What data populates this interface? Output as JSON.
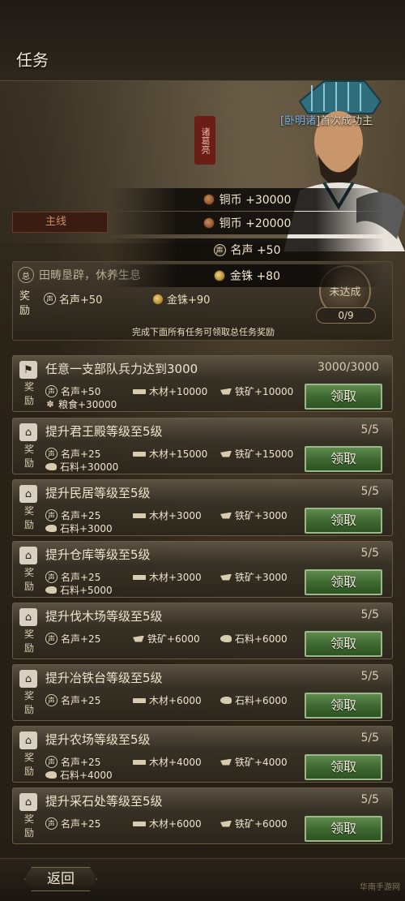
{
  "header": {
    "title": "任务"
  },
  "hero": {
    "caption_name": "[卧明诸",
    "caption_text": "]首次成功主",
    "seal_text": "诸葛亮"
  },
  "popup": {
    "rewards": [
      {
        "icon": "copper-coin-icon",
        "text": "铜币 +30000"
      },
      {
        "icon": "copper-coin-icon",
        "text": "铜币 +20000"
      },
      {
        "icon": "fame-icon",
        "text": "名声 +50"
      },
      {
        "icon": "gold-coin-icon",
        "text": "金铢 +80"
      }
    ],
    "mainline_tab": "主线"
  },
  "chapter": {
    "badge": "总",
    "title": "田畴垦辟，休养生息",
    "reward_label": "奖励",
    "rewards": [
      {
        "icon": "fame-icon",
        "text": "名声+50"
      },
      {
        "icon": "gold-coin-icon",
        "text": "金铢+90"
      }
    ],
    "chest_label": "未达成",
    "progress": "0/9",
    "hint": "完成下面所有任务可领取总任务奖励"
  },
  "reward_label": "奖励",
  "claim_label": "领取",
  "tasks": [
    {
      "title": "任意一支部队兵力达到3000",
      "progress": "3000/3000",
      "icon": "flag-icon",
      "rewards": [
        {
          "icon": "fame-icon",
          "text": "名声+50"
        },
        {
          "icon": "wood-icon",
          "text": "木材+10000"
        },
        {
          "icon": "iron-icon",
          "text": "铁矿+10000"
        },
        {
          "icon": "grain-icon",
          "text": "粮食+30000"
        }
      ]
    },
    {
      "title": "提升君王殿等级至5级",
      "progress": "5/5",
      "icon": "palace-icon",
      "rewards": [
        {
          "icon": "fame-icon",
          "text": "名声+25"
        },
        {
          "icon": "wood-icon",
          "text": "木材+15000"
        },
        {
          "icon": "iron-icon",
          "text": "铁矿+15000"
        },
        {
          "icon": "stone-icon",
          "text": "石料+30000"
        }
      ]
    },
    {
      "title": "提升民居等级至5级",
      "progress": "5/5",
      "icon": "house-icon",
      "rewards": [
        {
          "icon": "fame-icon",
          "text": "名声+25"
        },
        {
          "icon": "wood-icon",
          "text": "木材+3000"
        },
        {
          "icon": "iron-icon",
          "text": "铁矿+3000"
        },
        {
          "icon": "stone-icon",
          "text": "石料+3000"
        }
      ]
    },
    {
      "title": "提升仓库等级至5级",
      "progress": "5/5",
      "icon": "warehouse-icon",
      "rewards": [
        {
          "icon": "fame-icon",
          "text": "名声+25"
        },
        {
          "icon": "wood-icon",
          "text": "木材+3000"
        },
        {
          "icon": "iron-icon",
          "text": "铁矿+3000"
        },
        {
          "icon": "stone-icon",
          "text": "石料+5000"
        }
      ]
    },
    {
      "title": "提升伐木场等级至5级",
      "progress": "5/5",
      "icon": "lumber-icon",
      "rewards": [
        {
          "icon": "fame-icon",
          "text": "名声+25"
        },
        {
          "icon": "iron-icon",
          "text": "铁矿+6000"
        },
        {
          "icon": "stone-icon",
          "text": "石料+6000"
        }
      ]
    },
    {
      "title": "提升冶铁台等级至5级",
      "progress": "5/5",
      "icon": "forge-icon",
      "rewards": [
        {
          "icon": "fame-icon",
          "text": "名声+25"
        },
        {
          "icon": "wood-icon",
          "text": "木材+6000"
        },
        {
          "icon": "stone-icon",
          "text": "石料+6000"
        }
      ]
    },
    {
      "title": "提升农场等级至5级",
      "progress": "5/5",
      "icon": "farm-icon",
      "rewards": [
        {
          "icon": "fame-icon",
          "text": "名声+25"
        },
        {
          "icon": "wood-icon",
          "text": "木材+4000"
        },
        {
          "icon": "iron-icon",
          "text": "铁矿+4000"
        },
        {
          "icon": "stone-icon",
          "text": "石料+4000"
        }
      ]
    },
    {
      "title": "提升采石处等级至5级",
      "progress": "5/5",
      "icon": "quarry-icon",
      "rewards": [
        {
          "icon": "fame-icon",
          "text": "名声+25"
        },
        {
          "icon": "wood-icon",
          "text": "木材+6000"
        },
        {
          "icon": "iron-icon",
          "text": "铁矿+6000"
        }
      ]
    }
  ],
  "footer": {
    "back_label": "返回",
    "watermark": "华南手游网"
  },
  "colors": {
    "claim_green": "#3e6a32",
    "panel_brown": "#3a3226",
    "accent_blue": "#7fb6e8"
  }
}
